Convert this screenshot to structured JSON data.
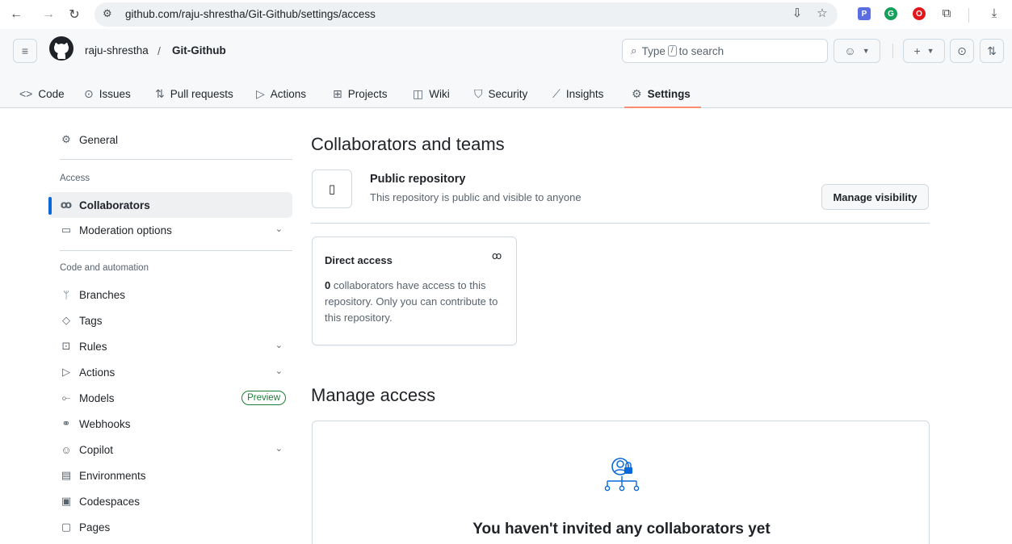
{
  "browser": {
    "url": "github.com/raju-shrestha/Git-Github/settings/access"
  },
  "header": {
    "owner": "raju-shrestha",
    "separator": "/",
    "repo": "Git-Github",
    "search_prefix": "Type",
    "search_key": "/",
    "search_suffix": "to search"
  },
  "tabs": [
    {
      "label": "Code",
      "icon": "code-icon"
    },
    {
      "label": "Issues",
      "icon": "issue-icon"
    },
    {
      "label": "Pull requests",
      "icon": "pull-request-icon"
    },
    {
      "label": "Actions",
      "icon": "play-icon"
    },
    {
      "label": "Projects",
      "icon": "table-icon"
    },
    {
      "label": "Wiki",
      "icon": "book-icon"
    },
    {
      "label": "Security",
      "icon": "shield-icon"
    },
    {
      "label": "Insights",
      "icon": "graph-icon"
    },
    {
      "label": "Settings",
      "icon": "gear-icon",
      "selected": true
    }
  ],
  "sidebar": {
    "general": "General",
    "access_heading": "Access",
    "collaborators": "Collaborators",
    "moderation": "Moderation options",
    "code_heading": "Code and automation",
    "branches": "Branches",
    "tags": "Tags",
    "rules": "Rules",
    "actions": "Actions",
    "models": "Models",
    "models_badge": "Preview",
    "webhooks": "Webhooks",
    "copilot": "Copilot",
    "environments": "Environments",
    "codespaces": "Codespaces",
    "pages": "Pages"
  },
  "main": {
    "title": "Collaborators and teams",
    "visibility_title": "Public repository",
    "visibility_desc": "This repository is public and visible to anyone",
    "manage_visibility": "Manage visibility",
    "direct_access_title": "Direct access",
    "direct_count": "0",
    "direct_text": "collaborators have access to this repository. Only you can contribute to this repository.",
    "manage_access_title": "Manage access",
    "empty_text": "You haven't invited any collaborators yet"
  },
  "colors": {
    "accent": "#0969da",
    "tab_underline": "#fd8c73",
    "preview_badge": "#1a7f37"
  }
}
